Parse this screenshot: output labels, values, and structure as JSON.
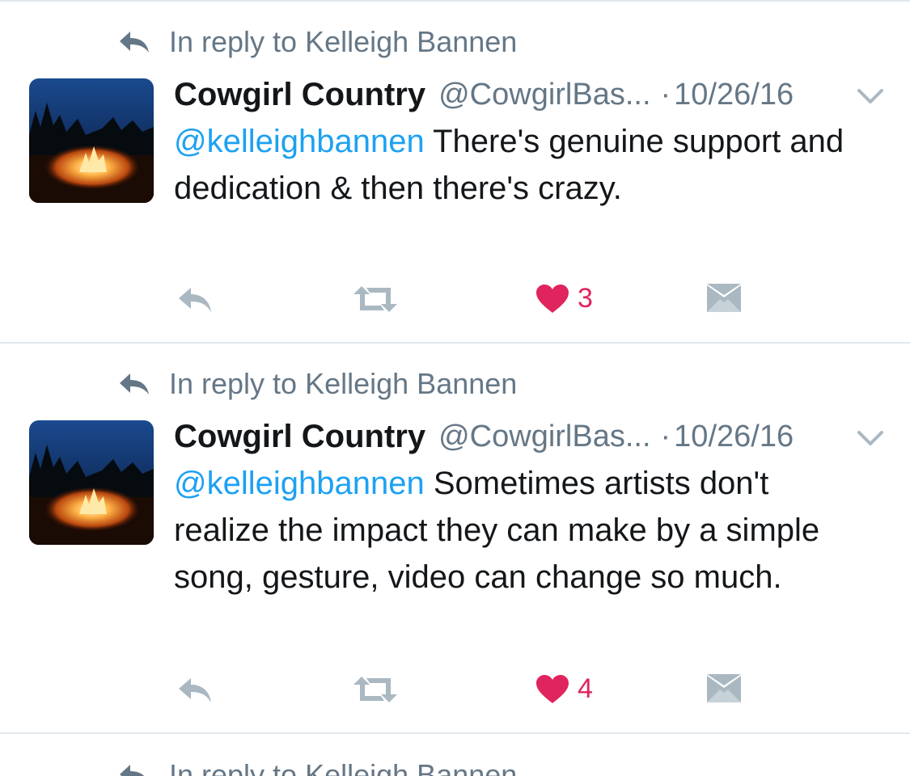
{
  "tweets": [
    {
      "reply_context": "In reply to Kelleigh Bannen",
      "display_name": "Cowgirl Country",
      "handle": "@CowgirlBas...",
      "separator": "·",
      "date": "10/26/16",
      "mention": "@kelleighbannen",
      "text": " There's genuine support and dedication & then there's crazy.",
      "like_count": "3",
      "liked": true
    },
    {
      "reply_context": "In reply to Kelleigh Bannen",
      "display_name": "Cowgirl Country",
      "handle": "@CowgirlBas...",
      "separator": "·",
      "date": "10/26/16",
      "mention": "@kelleighbannen",
      "text": " Sometimes artists don't realize the impact they can make by a simple song, gesture, video can change so much.",
      "like_count": "4",
      "liked": true
    },
    {
      "reply_context": "In reply to Kelleigh Bannen"
    }
  ],
  "colors": {
    "text": "#14171a",
    "muted": "#657786",
    "link": "#1da1f2",
    "like": "#e0245e",
    "icon": "#aab8c2",
    "divider": "#e1e8ed"
  },
  "icons": {
    "reply_context": "reply-arrow-icon",
    "reply": "reply-icon",
    "retweet": "retweet-icon",
    "like": "heart-icon",
    "dm": "envelope-icon",
    "menu": "chevron-down-icon"
  }
}
